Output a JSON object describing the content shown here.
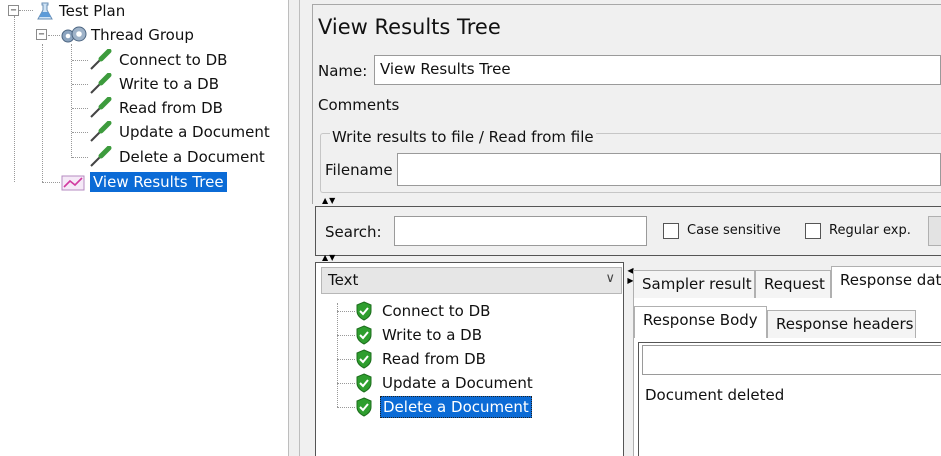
{
  "tree": {
    "test_plan": "Test Plan",
    "thread_group": "Thread Group",
    "samplers": [
      "Connect to DB",
      "Write to a DB",
      "Read from DB",
      "Update a Document",
      "Delete a Document"
    ],
    "listener": "View Results Tree"
  },
  "panel": {
    "title": "View Results Tree",
    "name_label": "Name:",
    "name_value": "View Results Tree",
    "comments_label": "Comments:",
    "file_legend": "Write results to file / Read from file",
    "filename_label": "Filename",
    "search_label": "Search:",
    "case_sensitive": "Case sensitive",
    "regular_exp": "Regular exp."
  },
  "results": {
    "renderer": "Text",
    "items": [
      "Connect to DB",
      "Write to a DB",
      "Read from DB",
      "Update a Document",
      "Delete a Document"
    ],
    "selected_index": 4
  },
  "tabs": {
    "top": [
      "Sampler result",
      "Request",
      "Response dat"
    ],
    "top_active": 2,
    "sub": [
      "Response Body",
      "Response headers"
    ],
    "sub_active": 0
  },
  "response_body": "Document deleted",
  "colors": {
    "selection": "#0b6bd6",
    "success": "#2e9e2e"
  }
}
